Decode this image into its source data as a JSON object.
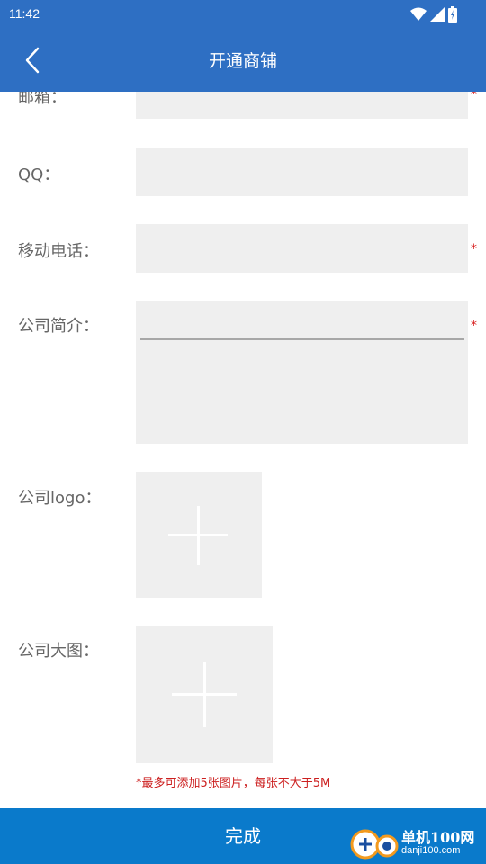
{
  "status_bar": {
    "time": "11:42"
  },
  "header": {
    "title": "开通商铺"
  },
  "form": {
    "email": {
      "label": "邮箱：",
      "value": "",
      "required": "*"
    },
    "qq": {
      "label": "QQ：",
      "value": ""
    },
    "mobile": {
      "label": "移动电话：",
      "value": "",
      "required": "*"
    },
    "intro": {
      "label": "公司简介：",
      "value": "",
      "required": "*"
    },
    "logo": {
      "label": "公司logo："
    },
    "banner": {
      "label": "公司大图：",
      "hint": "*最多可添加5张图片，每张不大于5M"
    }
  },
  "footer": {
    "done_label": "完成"
  },
  "watermark": {
    "line1": "单机100网",
    "line2": "danji100.com"
  },
  "colors": {
    "header": "#2e6fc3",
    "footer": "#0a7acb",
    "field_bg": "#efefef",
    "required": "#d81e1e"
  }
}
